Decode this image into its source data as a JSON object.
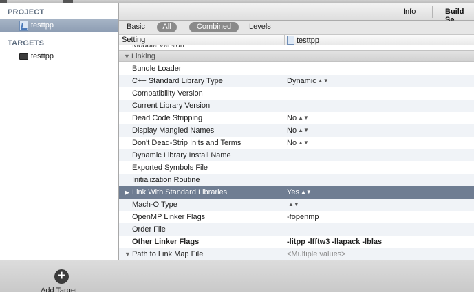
{
  "navigator": {
    "project_header": "PROJECT",
    "project_name": "testtpp",
    "targets_header": "TARGETS",
    "target_name": "testtpp"
  },
  "tabs": {
    "info": "Info",
    "build_settings": "Build Se"
  },
  "filter": {
    "basic": "Basic",
    "all": "All",
    "combined": "Combined",
    "levels": "Levels"
  },
  "table": {
    "setting_header": "Setting",
    "target_column": "testtpp",
    "partial_row": "Module Version",
    "group": "Linking",
    "rows": [
      {
        "name": "Bundle Loader",
        "value": ""
      },
      {
        "name": "C++ Standard Library Type",
        "value": "Dynamic"
      },
      {
        "name": "Compatibility Version",
        "value": ""
      },
      {
        "name": "Current Library Version",
        "value": ""
      },
      {
        "name": "Dead Code Stripping",
        "value": "No"
      },
      {
        "name": "Display Mangled Names",
        "value": "No"
      },
      {
        "name": "Don't Dead-Strip Inits and Terms",
        "value": "No"
      },
      {
        "name": "Dynamic Library Install Name",
        "value": ""
      },
      {
        "name": "Exported Symbols File",
        "value": ""
      },
      {
        "name": "Initialization Routine",
        "value": ""
      },
      {
        "name": "Link With Standard Libraries",
        "value": "Yes"
      },
      {
        "name": "Mach-O Type",
        "value": ""
      },
      {
        "name": "OpenMP Linker Flags",
        "value": "-fopenmp"
      },
      {
        "name": "Order File",
        "value": ""
      },
      {
        "name": "Other Linker Flags",
        "value": "-litpp -lfftw3 -llapack -lblas"
      },
      {
        "name": "Path to Link Map File",
        "value": "<Multiple values>"
      }
    ]
  },
  "bottom_bar": {
    "add_symbol": "+",
    "add_label": "Add Target"
  }
}
